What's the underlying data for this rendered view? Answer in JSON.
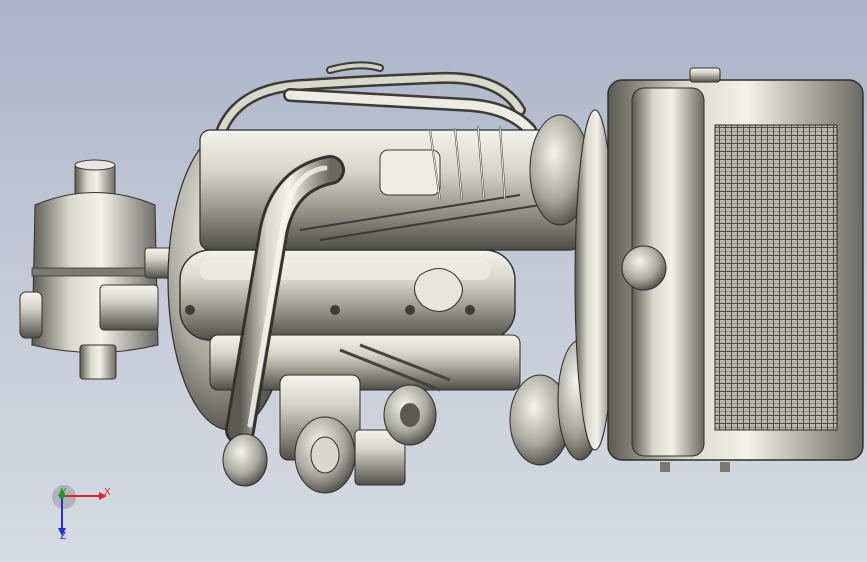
{
  "viewport": {
    "background_top": "#aab3c8",
    "background_bottom": "#d7dbe3",
    "model_name": ""
  },
  "triad": {
    "x_label": "X",
    "y_label": "Y",
    "z_label": "Z",
    "x_color": "#e0262a",
    "y_color": "#1f9b2a",
    "z_color": "#2230c8"
  },
  "icons": [
    "air-filter-icon",
    "engine-block-icon",
    "radiator-icon",
    "coordinate-triad-icon"
  ]
}
